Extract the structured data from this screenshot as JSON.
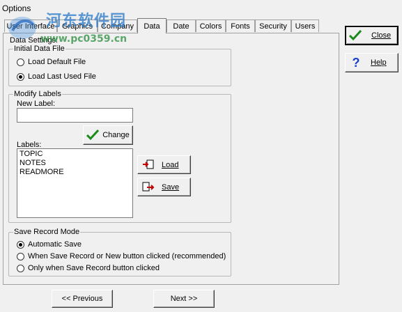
{
  "window": {
    "title": "Options"
  },
  "watermark": {
    "line1": "河东软件园",
    "line2": "www.pc0359.cn"
  },
  "tabs": [
    {
      "label": "User Interface",
      "active": false
    },
    {
      "label": "Graphics",
      "active": false
    },
    {
      "label": "Company",
      "active": false
    },
    {
      "label": "Data",
      "active": true
    },
    {
      "label": "Date",
      "active": false
    },
    {
      "label": "Colors",
      "active": false
    },
    {
      "label": "Fonts",
      "active": false
    },
    {
      "label": "Security",
      "active": false
    },
    {
      "label": "Users",
      "active": false
    }
  ],
  "panel": {
    "label": "Data Settings:"
  },
  "initial_data_file": {
    "label": "Initial Data File",
    "options": [
      {
        "label": "Load Default File",
        "checked": false
      },
      {
        "label": "Load Last Used File",
        "checked": true
      }
    ]
  },
  "modify_labels": {
    "label": "Modify Labels",
    "new_label": {
      "label": "New Label:",
      "value": ""
    },
    "change_button": "Change",
    "labels_label": "Labels:",
    "labels": [
      "TOPIC",
      "NOTES",
      "READMORE"
    ],
    "load_button": "Load",
    "save_button": "Save"
  },
  "save_record_mode": {
    "label": "Save Record Mode",
    "options": [
      {
        "label": "Automatic Save",
        "checked": true
      },
      {
        "label": "When Save Record or New button clicked (recommended)",
        "checked": false
      },
      {
        "label": "Only when Save Record button clicked",
        "checked": false
      }
    ]
  },
  "side_buttons": {
    "close": "Close",
    "help": "Help"
  },
  "nav": {
    "previous": "<< Previous",
    "next": "Next >>"
  },
  "colors": {
    "check_green": "#1a8a1a",
    "help_blue": "#1a3fd0"
  }
}
